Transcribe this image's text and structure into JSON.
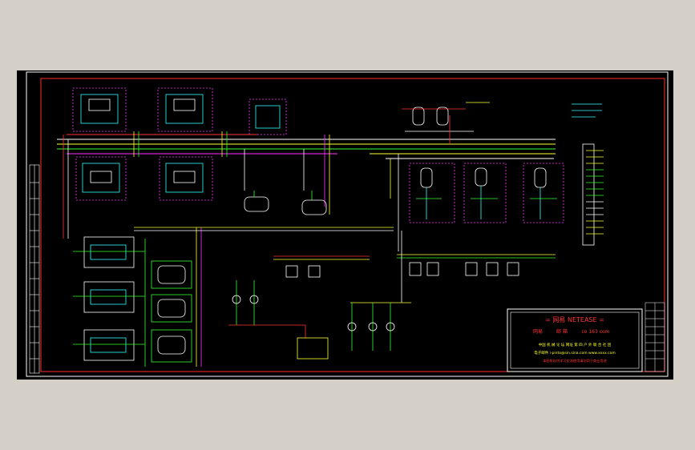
{
  "title_block": {
    "banner": "= 网易 NETEASE =",
    "line1_a": "网易",
    "line1_b": "邮 箱",
    "line1_c": "co 163 com",
    "line2": "中国  机 械 论 坛  网址  第  四  户  外  联  合  社  团",
    "line3": "电子邮件  i-pinto@sin.sina.com  www.xxxx.com",
    "line4": "本图纸仅供学习交流使用请勿用于商业用途"
  },
  "colors": {
    "background": "#000000",
    "frame": "#ff2a2a",
    "white": "#ffffff",
    "yellow": "#ffff33",
    "green": "#33ff33",
    "cyan": "#33ffff",
    "magenta": "#ff33ff",
    "red": "#ff3333"
  }
}
